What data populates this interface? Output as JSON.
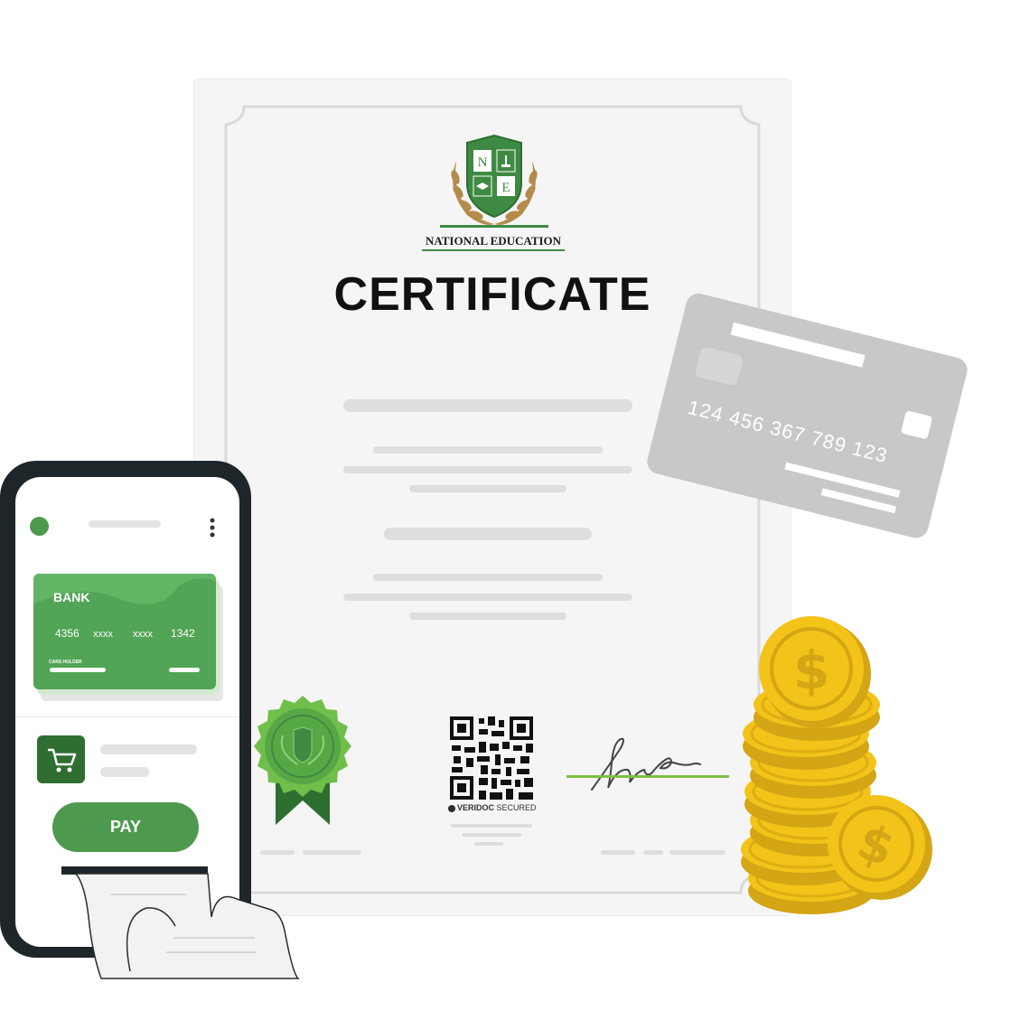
{
  "certificate": {
    "logo_caption": "NATIONAL EDUCATION",
    "logo_letter_top": "N",
    "logo_letter_bottom": "E",
    "title": "CERTIFICATE",
    "qr_caption_bold": "VERIDOC",
    "qr_caption_light": "SECURED",
    "seal_icon": "award-rosette-icon",
    "qr_icon": "qr-code-icon",
    "signature_icon": "signature-icon",
    "accent_green": "#3f8a43",
    "logo_gold": "#b58b4a"
  },
  "credit_card": {
    "number": "124 456 367 789 123",
    "color": "#c8c8c8"
  },
  "phone": {
    "bank_card": {
      "bank_name": "BANK",
      "number_groups": [
        "4356",
        "xxxx",
        "xxxx",
        "1342"
      ],
      "holder_label": "CARS HOLDER",
      "color": "#52a456"
    },
    "pay_label": "PAY",
    "cart_icon": "shopping-cart-icon",
    "menu_icon": "more-vertical-icon"
  },
  "coins": {
    "symbol": "$",
    "gold": "#f3c319"
  }
}
